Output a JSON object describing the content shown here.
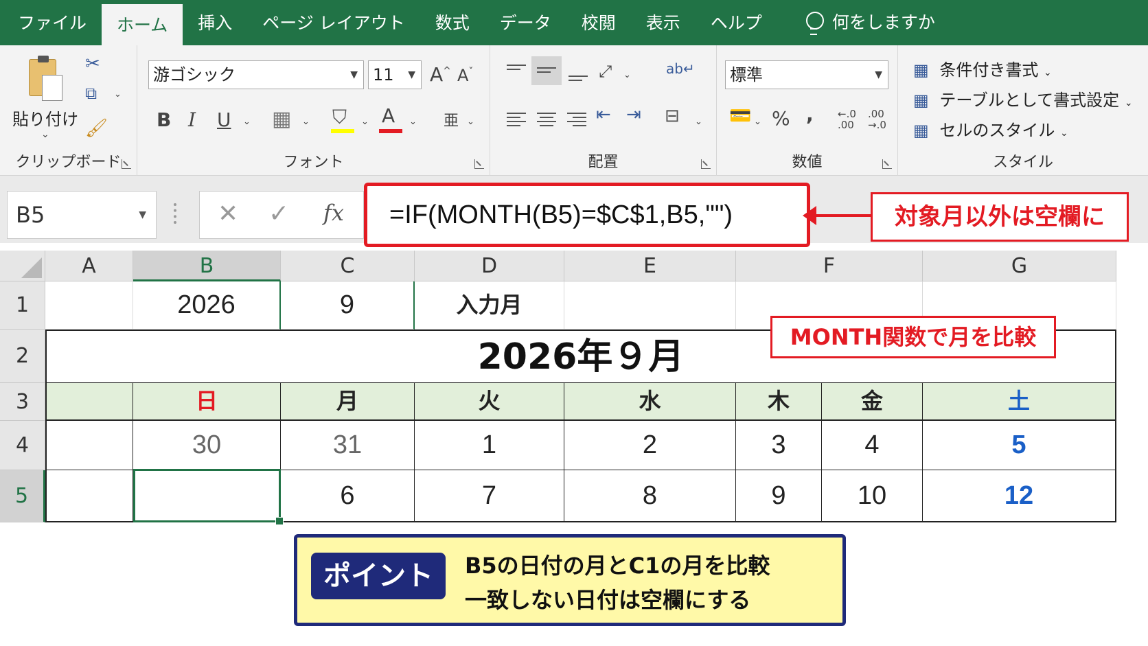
{
  "tabs": [
    {
      "label": "ファイル",
      "active": false
    },
    {
      "label": "ホーム",
      "active": true
    },
    {
      "label": "挿入",
      "active": false
    },
    {
      "label": "ページ レイアウト",
      "active": false
    },
    {
      "label": "数式",
      "active": false
    },
    {
      "label": "データ",
      "active": false
    },
    {
      "label": "校閲",
      "active": false
    },
    {
      "label": "表示",
      "active": false
    },
    {
      "label": "ヘルプ",
      "active": false
    }
  ],
  "tell_me": "何をしますか",
  "ribbon": {
    "clipboard": {
      "paste_label": "貼り付け",
      "group_label": "クリップボード"
    },
    "font": {
      "font_name": "游ゴシック",
      "font_size": "11",
      "grow": "A",
      "shrink": "A",
      "bold": "B",
      "italic": "I",
      "underline": "U",
      "font_color_letter": "A",
      "group_label": "フォント",
      "fill_color": "#ffff00",
      "font_color": "#e31b23"
    },
    "alignment": {
      "group_label": "配置"
    },
    "number": {
      "format": "標準",
      "percent": "%",
      "comma": ",",
      "inc_decimal": "←.0 .00",
      "dec_decimal": ".00 →.0",
      "group_label": "数値"
    },
    "styles": {
      "conditional": "条件付き書式",
      "table": "テーブルとして書式設定",
      "cell_styles": "セルのスタイル",
      "group_label": "スタイル"
    }
  },
  "formula_bar": {
    "name_box": "B5",
    "cancel": "✕",
    "enter": "✓",
    "fx": "fx",
    "formula": "=IF(MONTH(B5)=$C$1,B5,\"\")"
  },
  "callouts": {
    "formula_note": "対象月以外は空欄に",
    "month_note": "MONTH関数で月を比較"
  },
  "columns": [
    "A",
    "B",
    "C",
    "D",
    "E",
    "F",
    "G"
  ],
  "rows": [
    "1",
    "2",
    "3",
    "4",
    "5"
  ],
  "sheet": {
    "row1": {
      "B": "2026",
      "C": "9",
      "D": "入力月"
    },
    "title": "2026年９月",
    "weekdays": [
      "日",
      "月",
      "火",
      "水",
      "木",
      "金",
      "土"
    ],
    "row4": [
      "30",
      "31",
      "1",
      "2",
      "3",
      "4",
      "5"
    ],
    "row5": [
      "",
      "6",
      "7",
      "8",
      "9",
      "10",
      "12"
    ],
    "colors": {
      "sunday": "#e31b23",
      "saturday": "#1a5fc7",
      "other_month": "#666666",
      "header_fill": "#e2efda"
    }
  },
  "point": {
    "badge": "ポイント",
    "line1": "B5の日付の月とC1の月を比較",
    "line2": "一致しない日付は空欄にする"
  }
}
